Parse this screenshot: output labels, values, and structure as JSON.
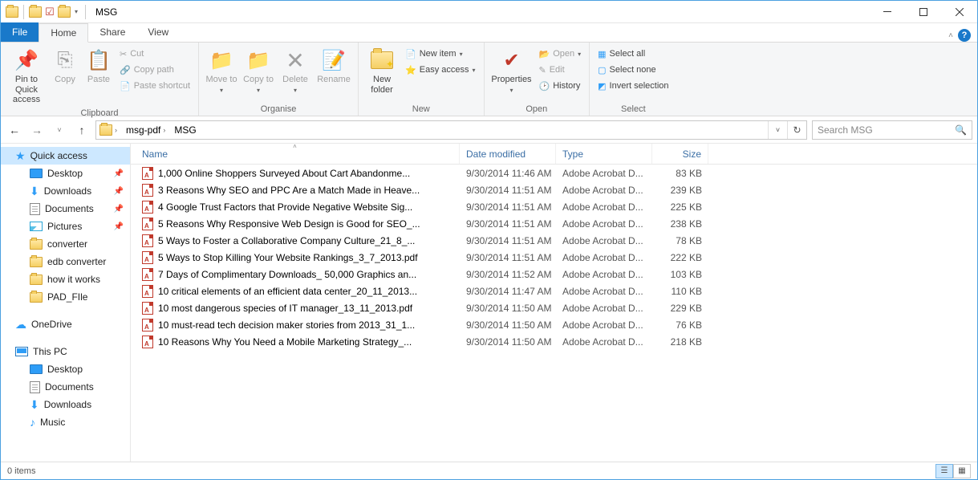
{
  "window": {
    "title": "MSG"
  },
  "tabs": {
    "file": "File",
    "home": "Home",
    "share": "Share",
    "view": "View"
  },
  "ribbon": {
    "clipboard": {
      "label": "Clipboard",
      "pin": "Pin to Quick access",
      "copy": "Copy",
      "paste": "Paste",
      "cut": "Cut",
      "copy_path": "Copy path",
      "paste_shortcut": "Paste shortcut"
    },
    "organise": {
      "label": "Organise",
      "move_to": "Move to",
      "copy_to": "Copy to",
      "delete": "Delete",
      "rename": "Rename"
    },
    "new": {
      "label": "New",
      "new_folder": "New folder",
      "new_item": "New item",
      "easy_access": "Easy access"
    },
    "open": {
      "label": "Open",
      "properties": "Properties",
      "open": "Open",
      "edit": "Edit",
      "history": "History"
    },
    "select": {
      "label": "Select",
      "select_all": "Select all",
      "select_none": "Select none",
      "invert": "Invert selection"
    }
  },
  "address": {
    "segments": [
      "msg-pdf",
      "MSG"
    ],
    "search_placeholder": "Search MSG"
  },
  "nav": {
    "quick_access": "Quick access",
    "desktop": "Desktop",
    "downloads": "Downloads",
    "documents": "Documents",
    "pictures": "Pictures",
    "converter": "converter",
    "edb_converter": "edb converter",
    "how_it_works": "how it works",
    "pad_file": "PAD_FIle",
    "onedrive": "OneDrive",
    "this_pc": "This PC",
    "music": "Music"
  },
  "columns": {
    "name": "Name",
    "date": "Date modified",
    "type": "Type",
    "size": "Size"
  },
  "files": [
    {
      "name": "1,000 Online Shoppers Surveyed About Cart Abandonme...",
      "date": "9/30/2014 11:46 AM",
      "type": "Adobe Acrobat D...",
      "size": "83 KB"
    },
    {
      "name": "3 Reasons Why SEO and PPC Are a Match Made in Heave...",
      "date": "9/30/2014 11:51 AM",
      "type": "Adobe Acrobat D...",
      "size": "239 KB"
    },
    {
      "name": "4 Google Trust Factors that Provide Negative Website Sig...",
      "date": "9/30/2014 11:51 AM",
      "type": "Adobe Acrobat D...",
      "size": "225 KB"
    },
    {
      "name": "5 Reasons Why Responsive Web Design is Good for SEO_...",
      "date": "9/30/2014 11:51 AM",
      "type": "Adobe Acrobat D...",
      "size": "238 KB"
    },
    {
      "name": "5 Ways to Foster a Collaborative Company Culture_21_8_...",
      "date": "9/30/2014 11:51 AM",
      "type": "Adobe Acrobat D...",
      "size": "78 KB"
    },
    {
      "name": "5 Ways to Stop Killing Your Website Rankings_3_7_2013.pdf",
      "date": "9/30/2014 11:51 AM",
      "type": "Adobe Acrobat D...",
      "size": "222 KB"
    },
    {
      "name": "7 Days of Complimentary Downloads_ 50,000 Graphics an...",
      "date": "9/30/2014 11:52 AM",
      "type": "Adobe Acrobat D...",
      "size": "103 KB"
    },
    {
      "name": "10 critical elements of an efficient data center_20_11_2013...",
      "date": "9/30/2014 11:47 AM",
      "type": "Adobe Acrobat D...",
      "size": "110 KB"
    },
    {
      "name": "10 most dangerous species of IT manager_13_11_2013.pdf",
      "date": "9/30/2014 11:50 AM",
      "type": "Adobe Acrobat D...",
      "size": "229 KB"
    },
    {
      "name": "10 must-read tech decision maker stories from 2013_31_1...",
      "date": "9/30/2014 11:50 AM",
      "type": "Adobe Acrobat D...",
      "size": "76 KB"
    },
    {
      "name": "10 Reasons Why You Need a Mobile Marketing Strategy_...",
      "date": "9/30/2014 11:50 AM",
      "type": "Adobe Acrobat D...",
      "size": "218 KB"
    }
  ],
  "status": {
    "items": "0 items"
  }
}
